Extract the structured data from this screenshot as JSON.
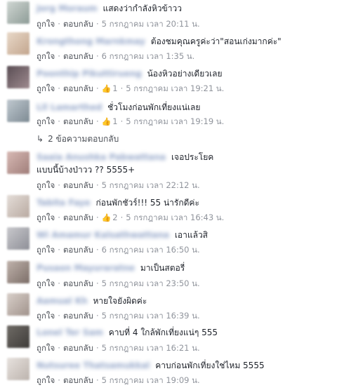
{
  "labels": {
    "like": "ถูกใจ",
    "reply": "ตอบกลับ",
    "dot": "·"
  },
  "comments": [
    {
      "name": "Jorg Moraum",
      "text": "แสดงว่ากำลังหิวข้าวว",
      "likes": "",
      "time": "5 กรกฎาคม เวลา 20:11 น."
    },
    {
      "name": "Krongthong Marnkmay",
      "text": "ต้องชมคุณครูค่ะว่า\"สอนเก่งมากค่ะ\"",
      "likes": "",
      "time": "6 กรกฎาคม เวลา 1:35 น."
    },
    {
      "name": "Poonthip Pikuttirueng",
      "text": "น้องหิวอย่างเดียวเลย",
      "likes": "1",
      "time": "5 กรกฎาคม เวลา 19:21 น."
    },
    {
      "name": "Lll Lamarthed",
      "text": "ชั่วโมงก่อนพักเที่ยงแน่เลย",
      "likes": "1",
      "time": "5 กรกฎาคม เวลา 19:19 น."
    },
    {
      "name": "Saaia Anushka Pabwattana",
      "text": "เจอประโยค",
      "text2": "แบบนี้บ้างป่าวว ?? 5555+",
      "likes": "",
      "time": "5 กรกฎาคม เวลา 22:12 น."
    },
    {
      "name": "Tabita Faye",
      "text": "ก่อนพักชัวร์!!! 55 น่ารักดีค่ะ",
      "likes": "2",
      "time": "5 กรกฎาคม เวลา 16:43 น."
    },
    {
      "name": "Wi Amamur Kalsathwattana",
      "text": "เอาแล้วสิ",
      "likes": "",
      "time": "6 กรกฎาคม เวลา 16:50 น."
    },
    {
      "name": "Pusaon Mayuraratne",
      "text": "มาเป็นสตอรี่",
      "likes": "",
      "time": "5 กรกฎาคม เวลา 23:50 น."
    },
    {
      "name": "Aamual Kh",
      "text": "หายใจยังผิดค่ะ",
      "likes": "",
      "time": "5 กรกฎาคม เวลา 16:39 น."
    },
    {
      "name": "Lonel Ter Sam",
      "text": "คาบที่ 4 ใกล้พักเที่ยงแน่ๆ 555",
      "likes": "",
      "time": "5 กรกฎาคม เวลา 16:21 น."
    },
    {
      "name": "Nutsuree Thatsamukkal",
      "text": "คาบก่อนพักเที่ยงใช่ไหม 5555",
      "likes": "",
      "time": "5 กรกฎาคม เวลา 19:09 น."
    }
  ],
  "replies_link": "2 ข้อความตอบกลับ"
}
